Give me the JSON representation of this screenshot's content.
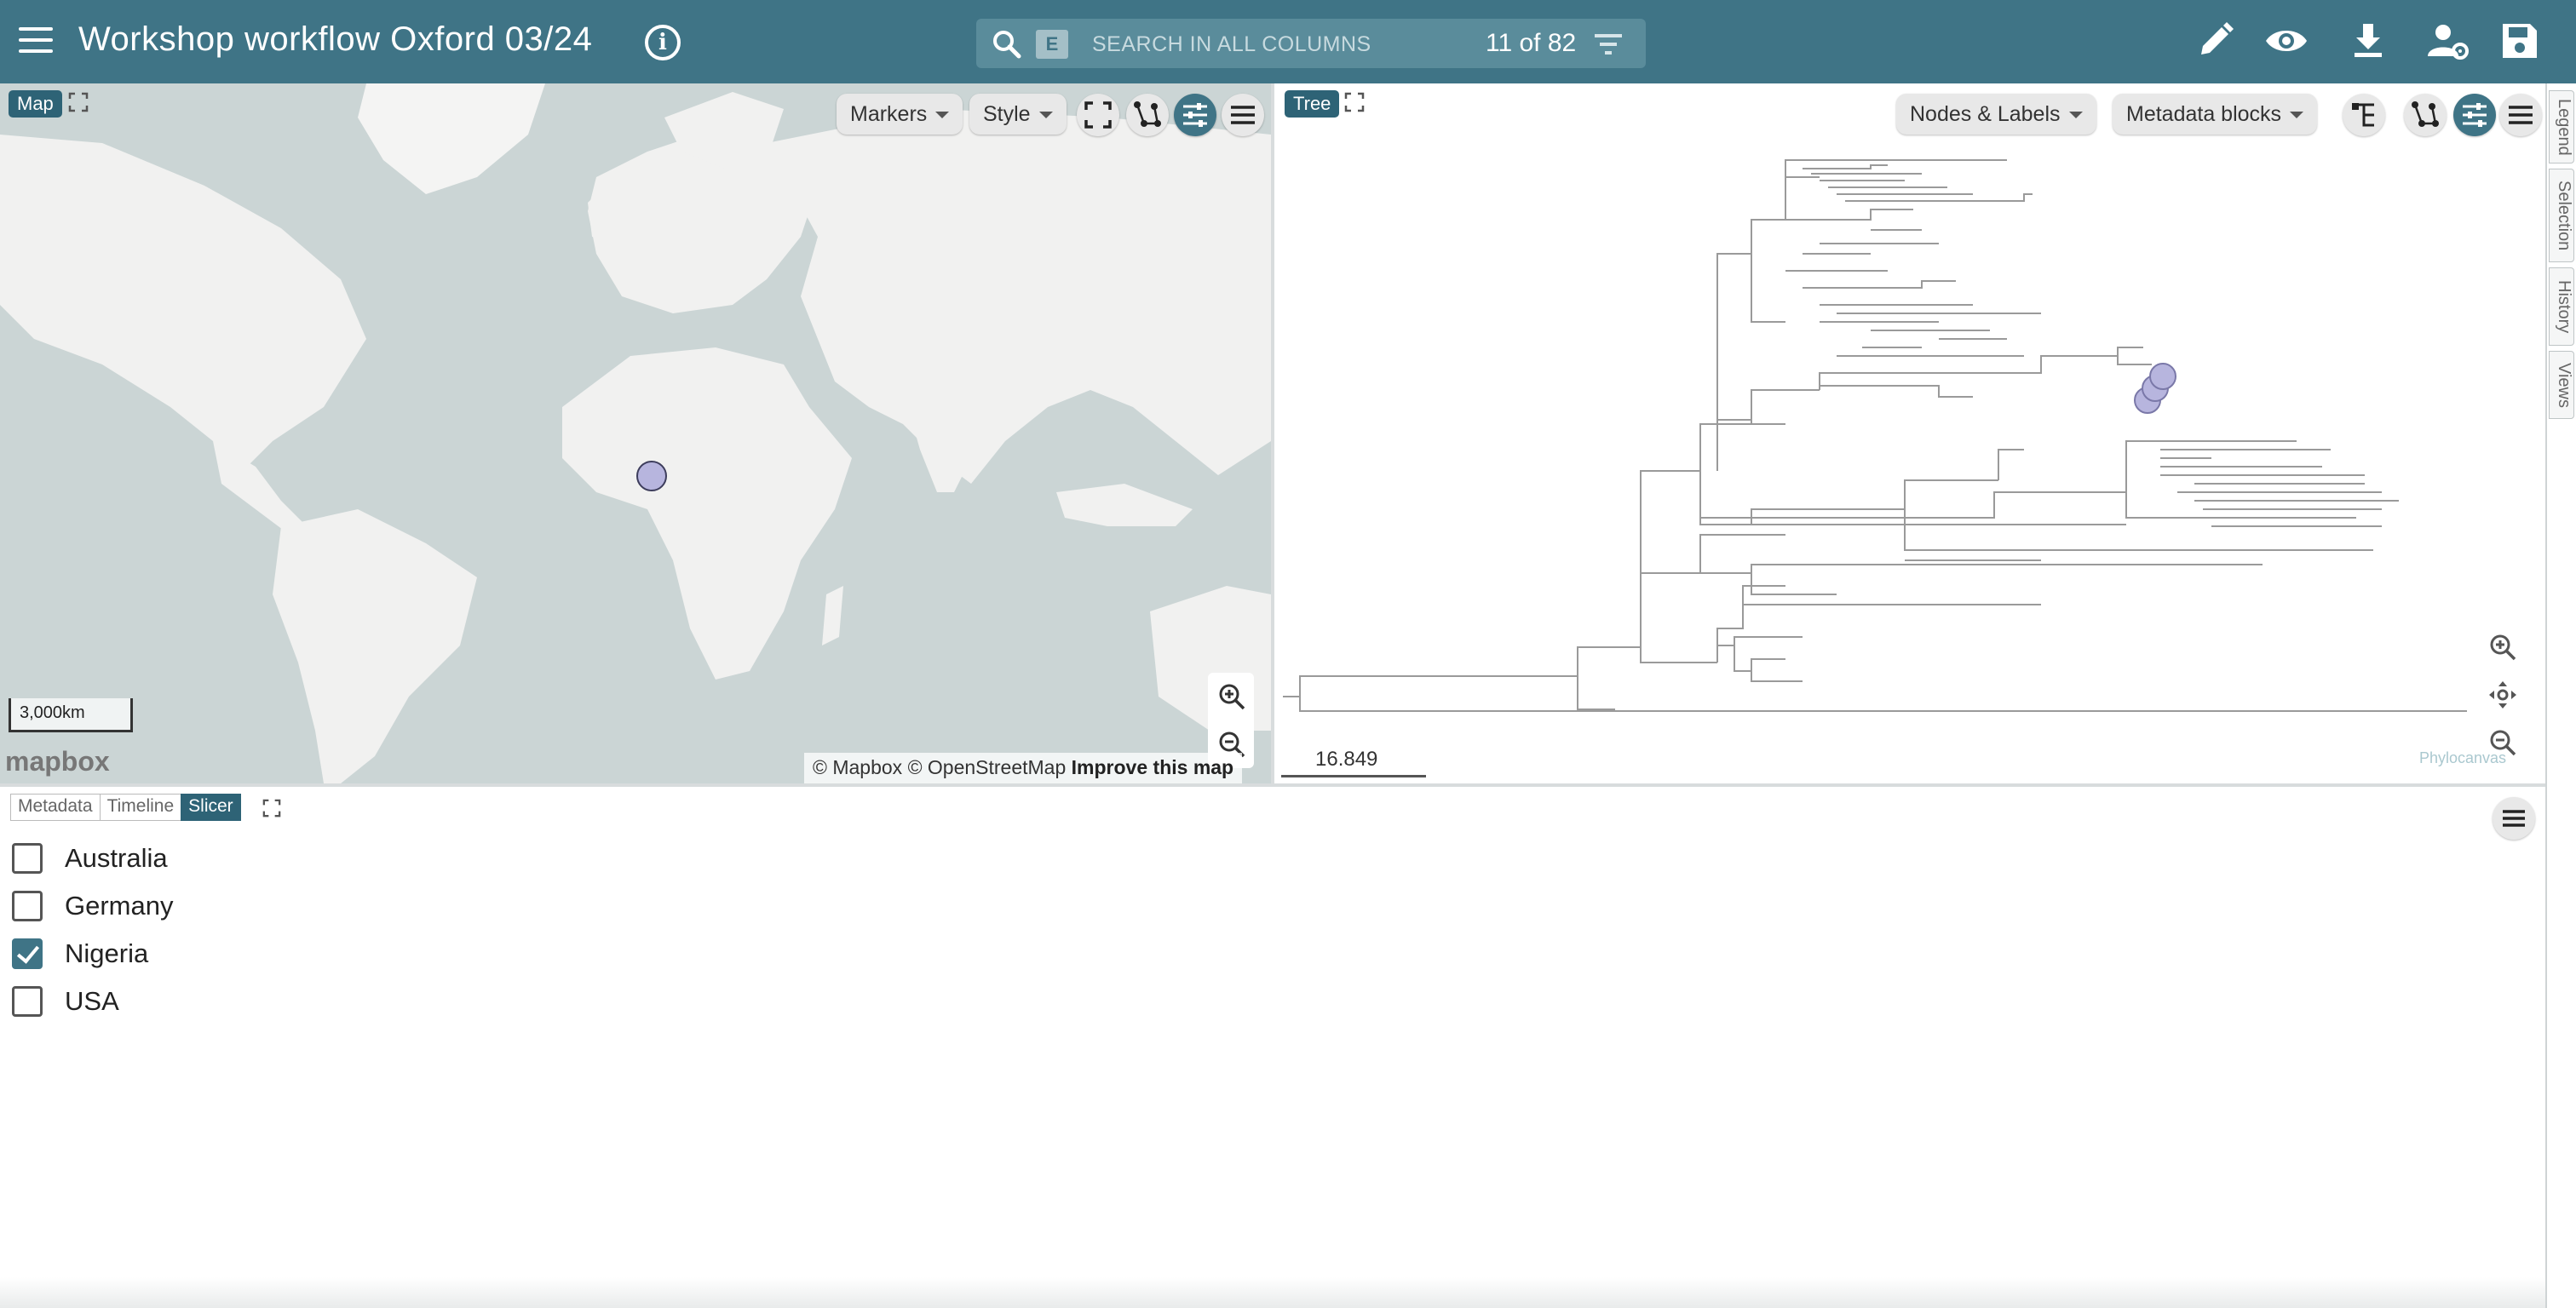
{
  "header": {
    "title": "Workshop workflow Oxford 03/24",
    "info_icon": "info-icon",
    "search": {
      "key_hint": "E",
      "placeholder": "SEARCH IN ALL COLUMNS",
      "count": "11 of 82"
    },
    "icons": [
      "pencil-icon",
      "eye-icon",
      "download-icon",
      "user-settings-icon",
      "save-icon"
    ],
    "background_color": "#3f7486"
  },
  "map_panel": {
    "badge": "Map",
    "controls": {
      "markers": "Markers",
      "style": "Style"
    },
    "scale_label": "3,000km",
    "logo_text": "mapbox",
    "attribution": {
      "mapbox": "© Mapbox",
      "osm": "© OpenStreetMap",
      "improve": "Improve this map"
    },
    "marker_color": "#b7b5de"
  },
  "tree_panel": {
    "badge": "Tree",
    "controls": {
      "nodes_labels": "Nodes & Labels",
      "metadata_blocks": "Metadata blocks"
    },
    "scale_value": "16.849",
    "logo_text": "Phylocanvas"
  },
  "side_tabs": [
    "Legend",
    "Selection",
    "History",
    "Views"
  ],
  "bottom_panel": {
    "tabs": [
      {
        "label": "Metadata",
        "active": false
      },
      {
        "label": "Timeline",
        "active": false
      },
      {
        "label": "Slicer",
        "active": true
      }
    ],
    "slicer_items": [
      {
        "label": "Australia",
        "checked": false
      },
      {
        "label": "Germany",
        "checked": false
      },
      {
        "label": "Nigeria",
        "checked": true
      },
      {
        "label": "USA",
        "checked": false
      }
    ]
  }
}
